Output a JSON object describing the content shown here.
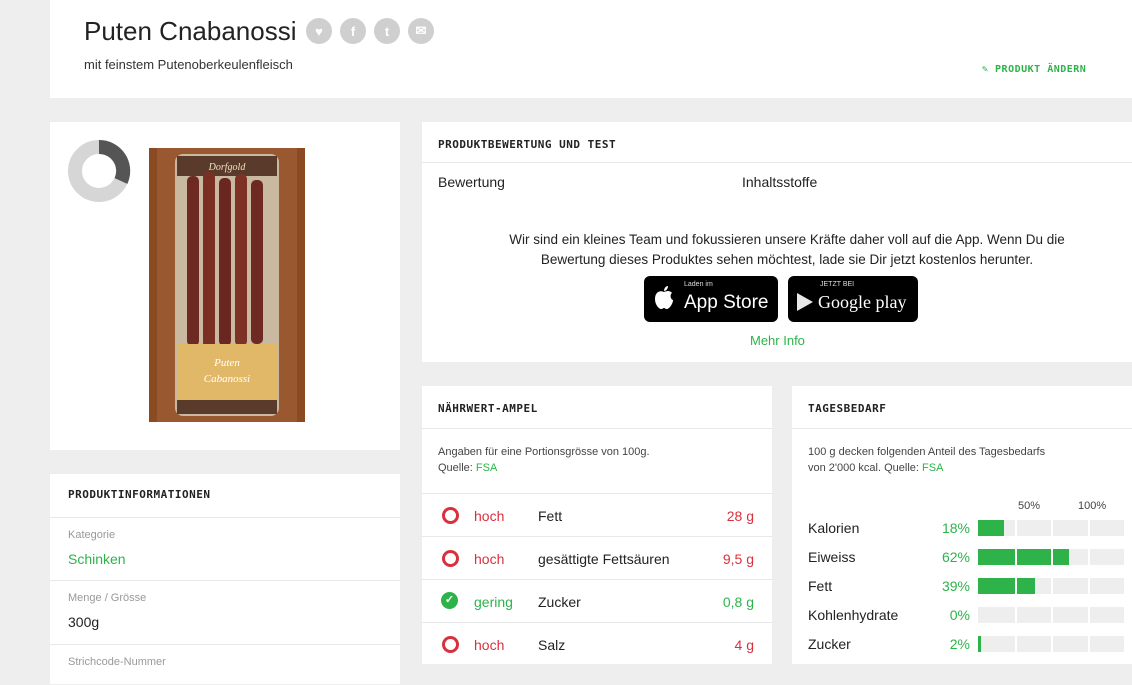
{
  "header": {
    "title": "Puten Cnabanossi",
    "subtitle": "mit feinstem Putenoberkeulenfleisch",
    "edit_label": "✎ PRODUKT ÄNDERN",
    "share_icons": [
      "like-icon",
      "facebook-icon",
      "twitter-icon",
      "mail-icon"
    ]
  },
  "product_image": {
    "brand_text": "Dorfgold",
    "label_line1": "Puten",
    "label_line2": "Cabanossi"
  },
  "product_info": {
    "heading": "PRODUKTINFORMATIONEN",
    "rows": [
      {
        "label": "Kategorie",
        "value": "Schinken"
      },
      {
        "label": "Menge / Grösse",
        "value": "300g"
      },
      {
        "label": "Strichcode-Nummer",
        "value": ""
      }
    ]
  },
  "rating": {
    "heading": "PRODUKTBEWERTUNG UND TEST",
    "tabs": [
      "Bewertung",
      "Inhaltsstoffe"
    ],
    "promo_line1": "Wir sind ein kleines Team und fokussieren unsere Kräfte daher voll auf die App. Wenn Du die",
    "promo_line2": "Bewertung dieses Produktes sehen möchtest, lade sie Dir jetzt kostenlos herunter.",
    "appstore_small": "Laden im",
    "appstore_big": "App Store",
    "googleplay_small": "JETZT BEI",
    "googleplay_big": "Google play",
    "more_info": "Mehr Info"
  },
  "ampel": {
    "heading": "NÄHRWERT-AMPEL",
    "note_line1": "Angaben für eine Portionsgrösse von 100g.",
    "note_source_prefix": "Quelle: ",
    "note_source": "FSA",
    "rows": [
      {
        "level": "hoch",
        "name": "Fett",
        "value": "28 g",
        "status": "high",
        "color": "#d9303e"
      },
      {
        "level": "hoch",
        "name": "gesättigte Fettsäuren",
        "value": "9,5 g",
        "status": "high",
        "color": "#d9303e"
      },
      {
        "level": "gering",
        "name": "Zucker",
        "value": "0,8 g",
        "status": "low",
        "color": "#2eb34b"
      },
      {
        "level": "hoch",
        "name": "Salz",
        "value": "4 g",
        "status": "high",
        "color": "#d9303e"
      }
    ]
  },
  "tagesbedarf": {
    "heading": "TAGESBEDARF",
    "note_line1": "100 g decken folgenden Anteil des Tagesbedarfs",
    "note_line2_prefix": "von 2'000 kcal. Quelle: ",
    "note_source": "FSA",
    "scale_50": "50%",
    "scale_100": "100%",
    "rows": [
      {
        "name": "Kalorien",
        "pct_label": "18%",
        "pct": 18
      },
      {
        "name": "Eiweiss",
        "pct_label": "62%",
        "pct": 62
      },
      {
        "name": "Fett",
        "pct_label": "39%",
        "pct": 39
      },
      {
        "name": "Kohlenhydrate",
        "pct_label": "0%",
        "pct": 0
      },
      {
        "name": "Zucker",
        "pct_label": "2%",
        "pct": 2
      }
    ]
  },
  "colors": {
    "accent_green": "#2eb34b",
    "high_red": "#d9303e",
    "background": "#eeeeee"
  }
}
